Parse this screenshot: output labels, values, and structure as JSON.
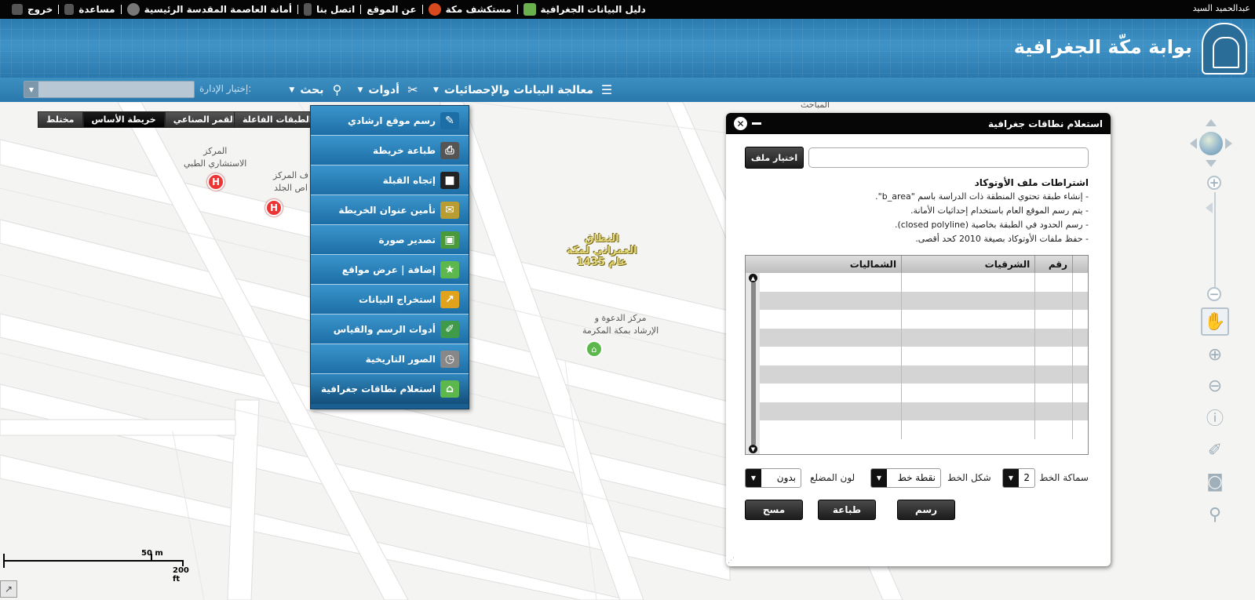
{
  "topbar": {
    "user_name": "عبدالحميد السيد",
    "links": [
      {
        "label": "دليل البيانات الجغرافية",
        "icon": "book-icon",
        "color": "#6ab04c"
      },
      {
        "label": "مستكشف مكة",
        "icon": "globe-icon",
        "color": "#d8491f"
      },
      {
        "label": "عن الموقع",
        "icon": "",
        "color": ""
      },
      {
        "label": "اتصل بنا",
        "icon": "phone-icon",
        "color": "#555"
      },
      {
        "label": "أمانة العاصمة المقدسة الرئيسية",
        "icon": "home-planet-icon",
        "color": "#777"
      },
      {
        "label": "مساعدة",
        "icon": "help-icon",
        "color": "#555"
      },
      {
        "label": "خروج",
        "icon": "logout-icon",
        "color": "#555"
      }
    ]
  },
  "header": {
    "title": "بوابة مكّة الجغرافية"
  },
  "navbar": {
    "items": [
      {
        "label": "معالجة البيانات والإحصائيات",
        "icon": "database-icon",
        "glyph": "☰"
      },
      {
        "label": "أدوات",
        "icon": "tools-icon",
        "glyph": "✂"
      },
      {
        "label": "بحث",
        "icon": "search-icon",
        "glyph": "⚲"
      }
    ],
    "department_label": "إختيار الإدارة:",
    "department_value": ""
  },
  "map": {
    "basemaps": [
      "مختلط",
      "خريطة الأساس",
      "القمر الصناعي"
    ],
    "active_basemap": "خريطة الأساس",
    "active_layers_label": "الطبقات الفاعلة",
    "labels": {
      "top_label": "المباحث",
      "hospital1": "المركز\nالاستشاري الطبي",
      "hospital2": "ف المركز\nاص الجلد",
      "mosque": "مركز الدعوة و\nالإرشاد بمكة المكرمة",
      "area": "النطاق\nالعمراني لمكة\n1435 عام"
    },
    "hospital_marker": "H",
    "scale": {
      "top_label": "50 m",
      "bottom_label": "200 ft"
    },
    "colors": {
      "road": "#ffffff",
      "road_edge": "#dedede",
      "hospital": "#e33333",
      "mosque": "#5cb84c"
    }
  },
  "tools_menu": {
    "items": [
      {
        "label": "رسم موقع ارشادي",
        "icon": "pin-draw-icon",
        "color": "#1d6ea6",
        "glyph": "✎"
      },
      {
        "label": "طباعة خريطة",
        "icon": "printer-icon",
        "color": "#555555",
        "glyph": "⎙"
      },
      {
        "label": "إتجاه القبلة",
        "icon": "kaaba-icon",
        "color": "#222222",
        "glyph": "■"
      },
      {
        "label": "تأمين عنوان الخريطة",
        "icon": "map-address-icon",
        "color": "#b99c32",
        "glyph": "✉"
      },
      {
        "label": "تصدير صورة",
        "icon": "export-image-icon",
        "color": "#4a9a3b",
        "glyph": "▣"
      },
      {
        "label": "إضافة | عرض مواقع",
        "icon": "add-location-icon",
        "color": "#5cb84c",
        "glyph": "★"
      },
      {
        "label": "استخراج البيانات",
        "icon": "extract-data-icon",
        "color": "#e0a31b",
        "glyph": "↗"
      },
      {
        "label": "أدوات الرسم والقياس",
        "icon": "ruler-pencil-icon",
        "color": "#3f9b4a",
        "glyph": "✐"
      },
      {
        "label": "الصور التاريخية",
        "icon": "historical-photos-icon",
        "color": "#888888",
        "glyph": "◷"
      },
      {
        "label": "استعلام نطاقات جغرافية",
        "icon": "geo-query-icon",
        "color": "#5cb84c",
        "glyph": "⌂"
      }
    ]
  },
  "cad_panel": {
    "title": "استعلام نطاقات جغرافية",
    "choose_file_label": "اختيار ملف",
    "requirements_title": "اشتراطات ملف الأوتوكاد",
    "requirements": [
      "- إنشاء طبقة تحتوي المنطقة ذات الدراسة باسم \"b_area\".",
      "- يتم رسم الموقع العام باستخدام إحداثيات الأمانة.",
      "- رسم الحدود في الطبقة بخاصية (closed polyline).",
      "- حفظ ملفات الأوتوكاد بصيغة 2010 كحد أقصى."
    ],
    "columns": [
      "رقم",
      "الشرقيات",
      "الشماليات"
    ],
    "rows": [
      [
        "",
        "",
        ""
      ],
      [
        "",
        "",
        ""
      ],
      [
        "",
        "",
        ""
      ],
      [
        "",
        "",
        ""
      ],
      [
        "",
        "",
        ""
      ],
      [
        "",
        "",
        ""
      ],
      [
        "",
        "",
        ""
      ],
      [
        "",
        "",
        ""
      ],
      [
        "",
        "",
        ""
      ]
    ],
    "line_width_label": "سماكة الخط",
    "line_width_value": "2",
    "line_style_label": "شكل الخط",
    "line_style_value": "نقطة خط",
    "polygon_color_label": "لون المضلع",
    "polygon_color_value": "بدون",
    "buttons": {
      "draw": "رسم",
      "print": "طباعة",
      "clear": "مسح"
    }
  }
}
